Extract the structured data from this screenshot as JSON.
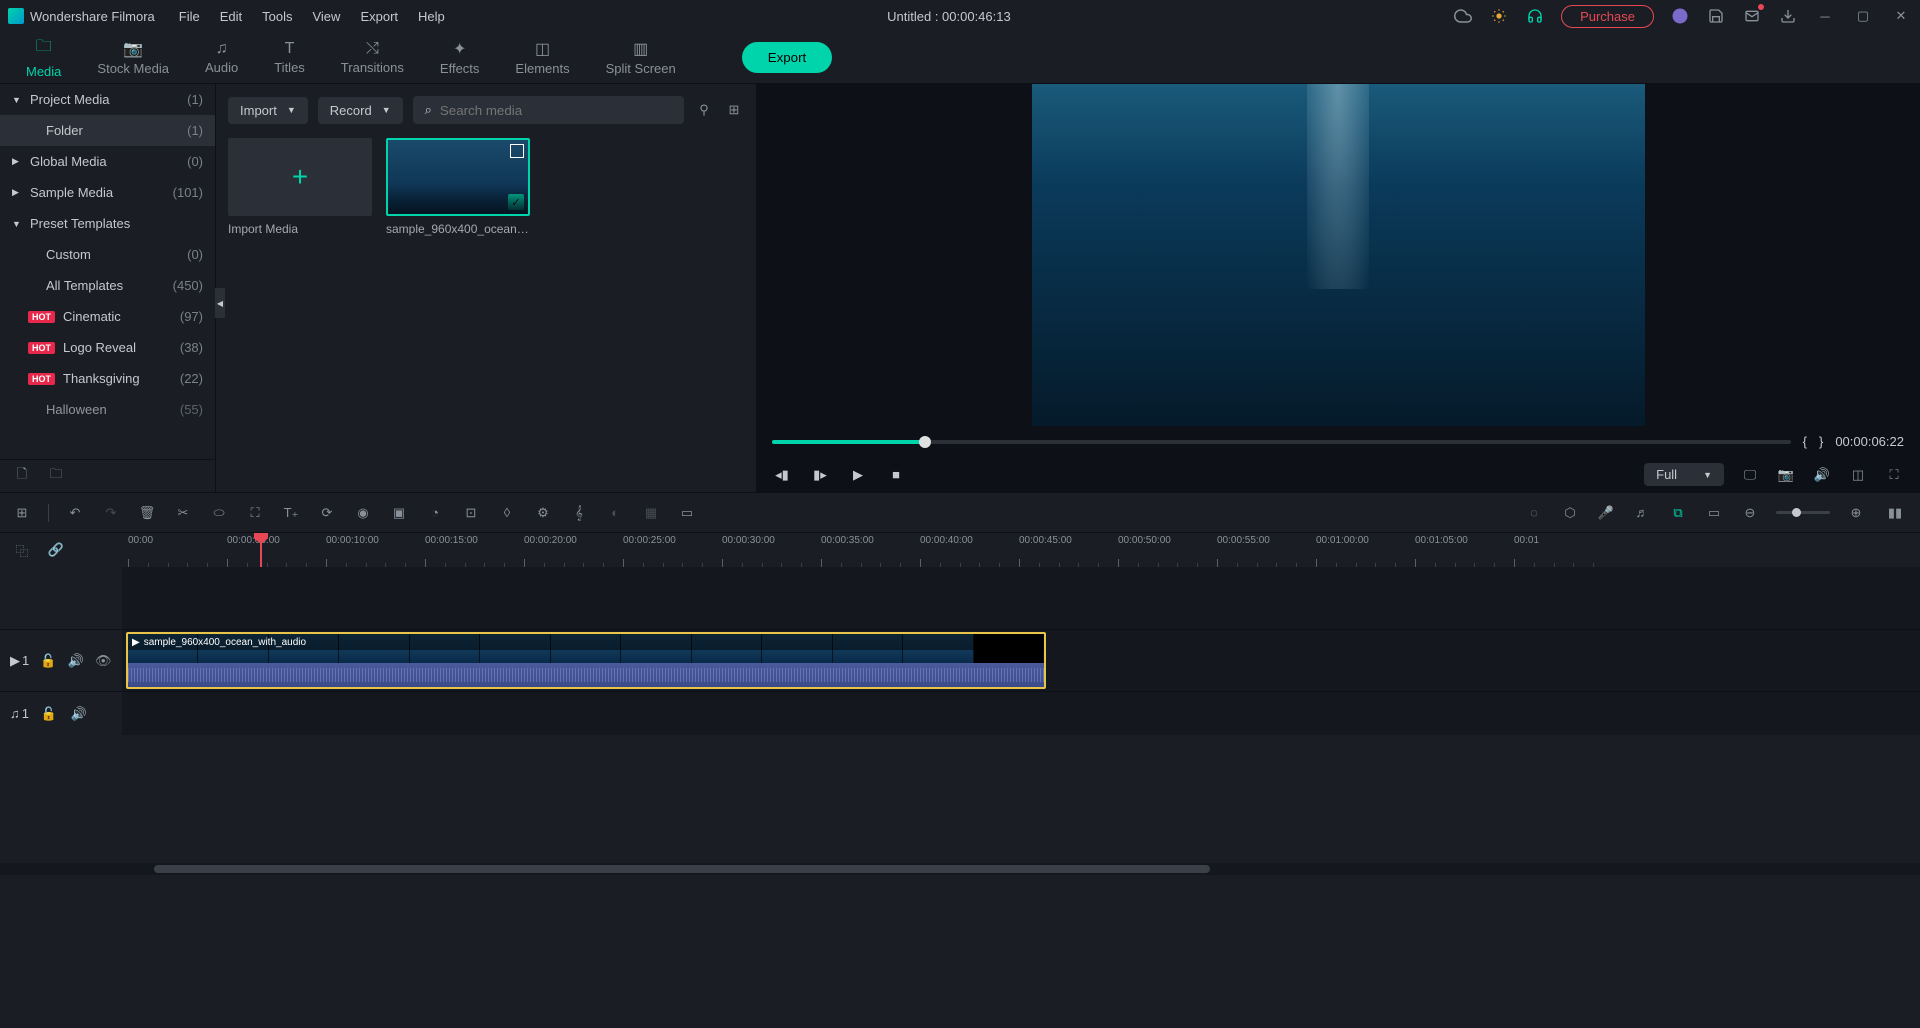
{
  "app": {
    "name": "Wondershare Filmora",
    "title": "Untitled : 00:00:46:13"
  },
  "menu": {
    "file": "File",
    "edit": "Edit",
    "tools": "Tools",
    "view": "View",
    "export": "Export",
    "help": "Help"
  },
  "purchase": "Purchase",
  "tabs": {
    "media": "Media",
    "stock": "Stock Media",
    "audio": "Audio",
    "titles": "Titles",
    "transitions": "Transitions",
    "effects": "Effects",
    "elements": "Elements",
    "split": "Split Screen"
  },
  "export_btn": "Export",
  "sidebar": {
    "project_media": {
      "label": "Project Media",
      "count": "(1)"
    },
    "folder": {
      "label": "Folder",
      "count": "(1)"
    },
    "global_media": {
      "label": "Global Media",
      "count": "(0)"
    },
    "sample_media": {
      "label": "Sample Media",
      "count": "(101)"
    },
    "preset_templates": {
      "label": "Preset Templates"
    },
    "custom": {
      "label": "Custom",
      "count": "(0)"
    },
    "all_templates": {
      "label": "All Templates",
      "count": "(450)"
    },
    "cinematic": {
      "label": "Cinematic",
      "count": "(97)"
    },
    "logo_reveal": {
      "label": "Logo Reveal",
      "count": "(38)"
    },
    "thanksgiving": {
      "label": "Thanksgiving",
      "count": "(22)"
    },
    "halloween": {
      "label": "Halloween",
      "count": "(55)"
    },
    "hot": "HOT"
  },
  "media_toolbar": {
    "import": "Import",
    "record": "Record",
    "search_placeholder": "Search media"
  },
  "media_items": {
    "import_media": "Import Media",
    "sample_ocean": "sample_960x400_ocean_..."
  },
  "preview": {
    "timecode": "00:00:06:22",
    "mark_in": "{",
    "mark_out": "}",
    "quality": "Full"
  },
  "timeline": {
    "timecodes": [
      "00:00",
      "00:00:05:00",
      "00:00:10:00",
      "00:00:15:00",
      "00:00:20:00",
      "00:00:25:00",
      "00:00:30:00",
      "00:00:35:00",
      "00:00:40:00",
      "00:00:45:00",
      "00:00:50:00",
      "00:00:55:00",
      "00:01:00:00",
      "00:01:05:00",
      "00:01"
    ],
    "clip_name": "sample_960x400_ocean_with_audio",
    "video_track": "1",
    "audio_track": "1"
  }
}
